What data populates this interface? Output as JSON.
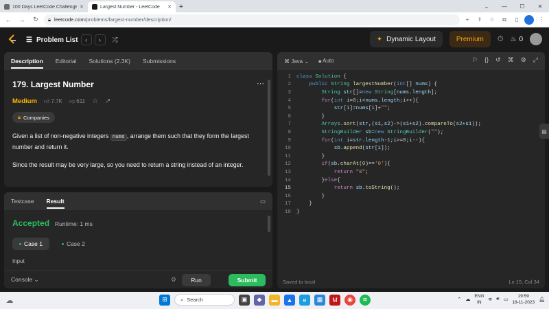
{
  "browser": {
    "tabs": [
      {
        "title": "100 Days LeetCode Challenge - ...",
        "active": false
      },
      {
        "title": "Largest Number - LeetCode",
        "active": true
      }
    ],
    "url_host": "leetcode.com",
    "url_path": "/problems/largest-number/description/",
    "profile_initial": "P"
  },
  "nav": {
    "problem_list": "Problem List",
    "dynamic_layout": "Dynamic Layout",
    "premium": "Premium",
    "streak": "0"
  },
  "description_panel": {
    "tabs": [
      "Description",
      "Editorial",
      "Solutions (2.3K)",
      "Submissions"
    ],
    "title": "179. Largest Number",
    "difficulty": "Medium",
    "likes": "7.7K",
    "dislikes": "611",
    "companies": "Companies",
    "text1_a": "Given a list of non-negative integers ",
    "text1_code": "nums",
    "text1_b": ", arrange them such that they form the largest number and return it.",
    "text2": "Since the result may be very large, so you need to return a string instead of an integer."
  },
  "result_panel": {
    "tabs": [
      "Testcase",
      "Result"
    ],
    "status": "Accepted",
    "runtime": "Runtime: 1 ms",
    "cases": [
      "Case 1",
      "Case 2"
    ],
    "input_label": "Input",
    "console": "Console",
    "run": "Run",
    "submit": "Submit"
  },
  "editor": {
    "language": "Java",
    "mode": "Auto",
    "saved": "Saved to local",
    "cursor": "Ln 15, Col 34",
    "current_line": 15
  },
  "taskbar": {
    "search": "Search",
    "lang_top": "ENG",
    "lang_bottom": "IN",
    "time": "19:59",
    "date": "18-11-2023"
  }
}
